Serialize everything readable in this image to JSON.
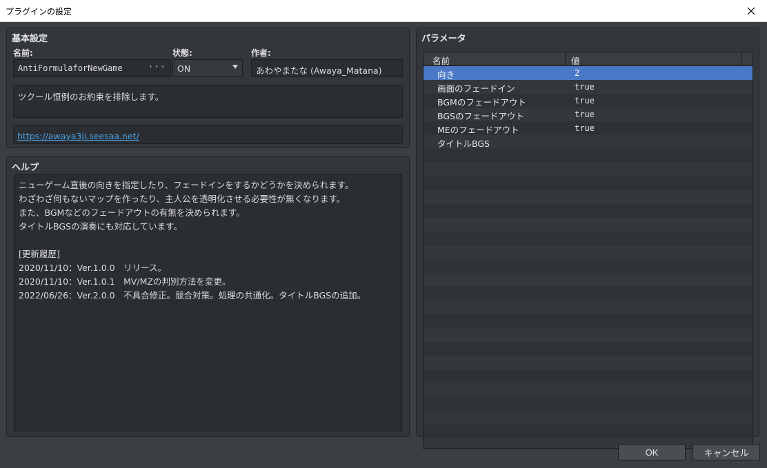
{
  "window": {
    "title": "プラグインの設定"
  },
  "basic": {
    "title": "基本設定",
    "name_label": "名前:",
    "name_value": "AntiFormulaforNewGame",
    "name_more": "···",
    "status_label": "状態:",
    "status_value": "ON",
    "author_label": "作者:",
    "author_value": "あわやまたな (Awaya_Matana)",
    "description": "ツクール恒例のお約束を排除します。",
    "url": "https://awaya3ji.seesaa.net/"
  },
  "help": {
    "title": "ヘルプ",
    "text": "ニューゲーム直後の向きを指定したり、フェードインをするかどうかを決められます。\nわざわざ何もないマップを作ったり、主人公を透明化させる必要性が無くなります。\nまた、BGMなどのフェードアウトの有無を決められます。\nタイトルBGSの演奏にも対応しています。\n\n[更新履歴]\n2020/11/10：Ver.1.0.0　リリース。\n2020/11/10：Ver.1.0.1　MV/MZの判別方法を変更。\n2022/06/26：Ver.2.0.0　不具合修正。競合対策。処理の共通化。タイトルBGSの追加。"
  },
  "params": {
    "title": "パラメータ",
    "col_name": "名前",
    "col_value": "値",
    "rows": [
      {
        "name": "向き",
        "value": "2"
      },
      {
        "name": "画面のフェードイン",
        "value": "true"
      },
      {
        "name": "BGMのフェードアウト",
        "value": "true"
      },
      {
        "name": "BGSのフェードアウト",
        "value": "true"
      },
      {
        "name": "MEのフェードアウト",
        "value": "true"
      },
      {
        "name": "タイトルBGS",
        "value": ""
      }
    ]
  },
  "buttons": {
    "ok": "OK",
    "cancel": "キャンセル"
  }
}
